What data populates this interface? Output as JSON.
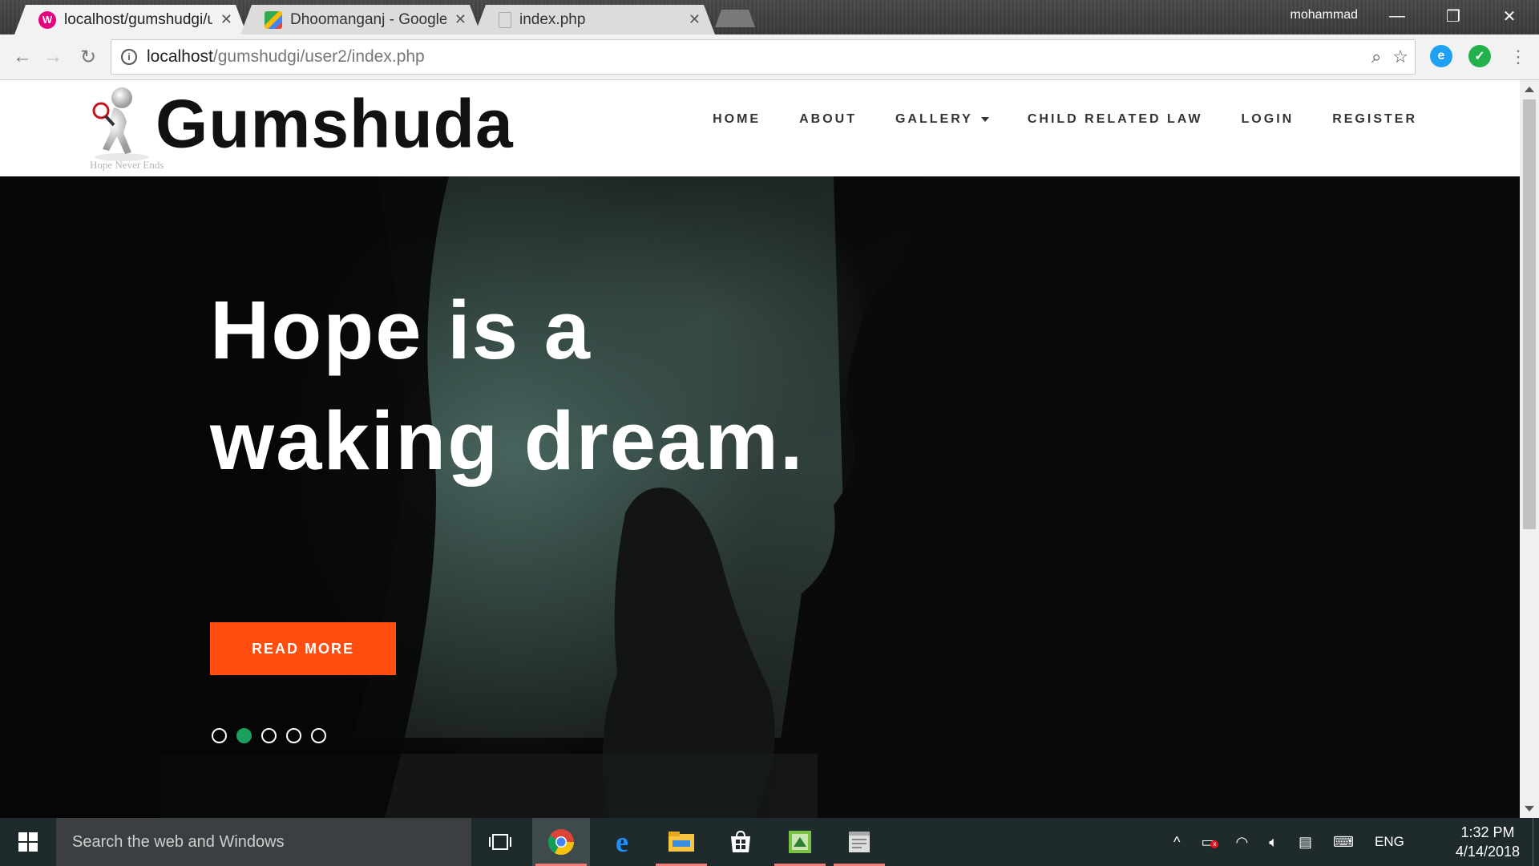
{
  "browser": {
    "tabs": [
      {
        "title": "localhost/gumshudgi/use",
        "favicon": "wamp-icon",
        "color": "#e6007e",
        "active": true
      },
      {
        "title": "Dhoomanganj - Google M",
        "favicon": "maps-icon",
        "color": "#34a853",
        "active": false
      },
      {
        "title": "index.php",
        "favicon": "file-icon",
        "color": "#9e9e9e",
        "active": false
      }
    ],
    "user": "mohammad",
    "url_host": "localhost",
    "url_path": "/gumshudgi/user2/index.php"
  },
  "site": {
    "logo_text": "Gumshuda",
    "tagline": "Hope Never Ends",
    "nav": [
      {
        "label": "HOME"
      },
      {
        "label": "ABOUT"
      },
      {
        "label": "GALLERY",
        "has_dropdown": true
      },
      {
        "label": "CHILD RELATED LAW"
      },
      {
        "label": "LOGIN"
      },
      {
        "label": "REGISTER"
      }
    ]
  },
  "hero": {
    "line1": "Hope is a",
    "line2": "waking dream.",
    "button": "READ MORE",
    "button_color": "#ff4e0f",
    "slides_total": 5,
    "active_slide": 2,
    "active_dot_color": "#1a9f5e"
  },
  "taskbar": {
    "search_placeholder": "Search the web and Windows",
    "language": "ENG",
    "time": "1:32 PM",
    "date": "4/14/2018",
    "pinned": [
      "task-view-icon",
      "chrome-icon",
      "edge-icon",
      "file-explorer-icon",
      "store-icon",
      "app-icon",
      "notepad-icon"
    ]
  }
}
